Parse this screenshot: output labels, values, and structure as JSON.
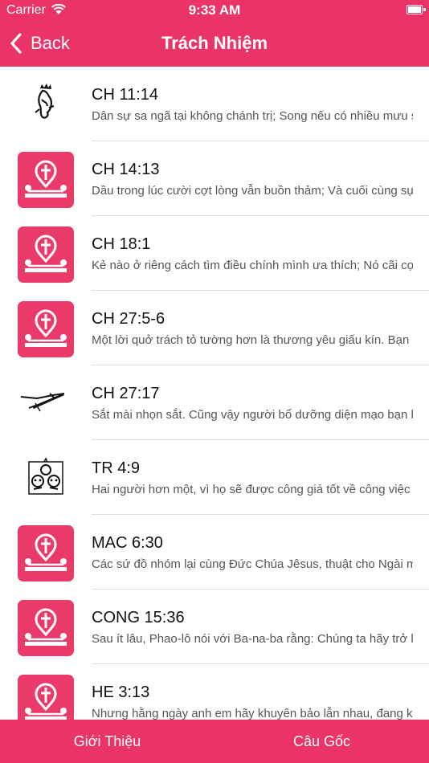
{
  "status_bar": {
    "carrier": "Carrier",
    "time": "9:33 AM"
  },
  "nav": {
    "back_label": "Back",
    "title": "Trách Nhiệm"
  },
  "items": [
    {
      "ref": "CH 11:14",
      "text": "Dân sự sa ngã tại không chánh trị; Song nếu có nhiều mưu sĩ, thì được an toàn.",
      "icon": "crowned-figure-sketch"
    },
    {
      "ref": "CH 14:13",
      "text": "Dầu trong lúc cười cợt lòng vẫn buồn thảm; Và cuối cùng sự vui, ấy là sự sầu não.",
      "icon": "cross-badge"
    },
    {
      "ref": "CH 18:1",
      "text": "Kẻ nào ở riêng cách tìm điều chính mình ưa thích; Nó cãi cọ với mọi sự khôn ngoan thật.",
      "icon": "cross-badge"
    },
    {
      "ref": "CH 27:5-6",
      "text": "Một lời quở trách tỏ tường hơn là thương yêu giấu kín. Bạn hữu làm cho thương tích.",
      "icon": "cross-badge"
    },
    {
      "ref": "CH 27:17",
      "text": "Sắt mài nhọn sắt. Cũng vậy người bổ dưỡng diện mạo bạn hữu mình.",
      "icon": "iron-blades-sketch"
    },
    {
      "ref": "TR 4:9",
      "text": "Hai người hơn một, vì họ sẽ được công giá tốt về công việc mình.",
      "icon": "three-faces-sketch"
    },
    {
      "ref": "MAC 6:30",
      "text": "Các sứ đồ nhóm lại cùng Đức Chúa Jêsus, thuật cho Ngài mọi điều mình đã làm.",
      "icon": "cross-badge"
    },
    {
      "ref": "CONG 15:36",
      "text": "Sau ít lâu, Phao-lô nói với Ba-na-ba rằng: Chúng ta hãy trở lại thăm hết thảy anh em.",
      "icon": "cross-badge"
    },
    {
      "ref": "HE 3:13",
      "text": "Nhưng hằng ngày anh em hãy khuyên bảo lẫn nhau, đang khi còn gọi là Ngày nay.",
      "icon": "cross-badge"
    }
  ],
  "tabs": [
    {
      "label": "Giới Thiệu"
    },
    {
      "label": "Câu Gốc"
    }
  ],
  "colors": {
    "accent": "#ea3468",
    "badge": "#e93a6a"
  }
}
